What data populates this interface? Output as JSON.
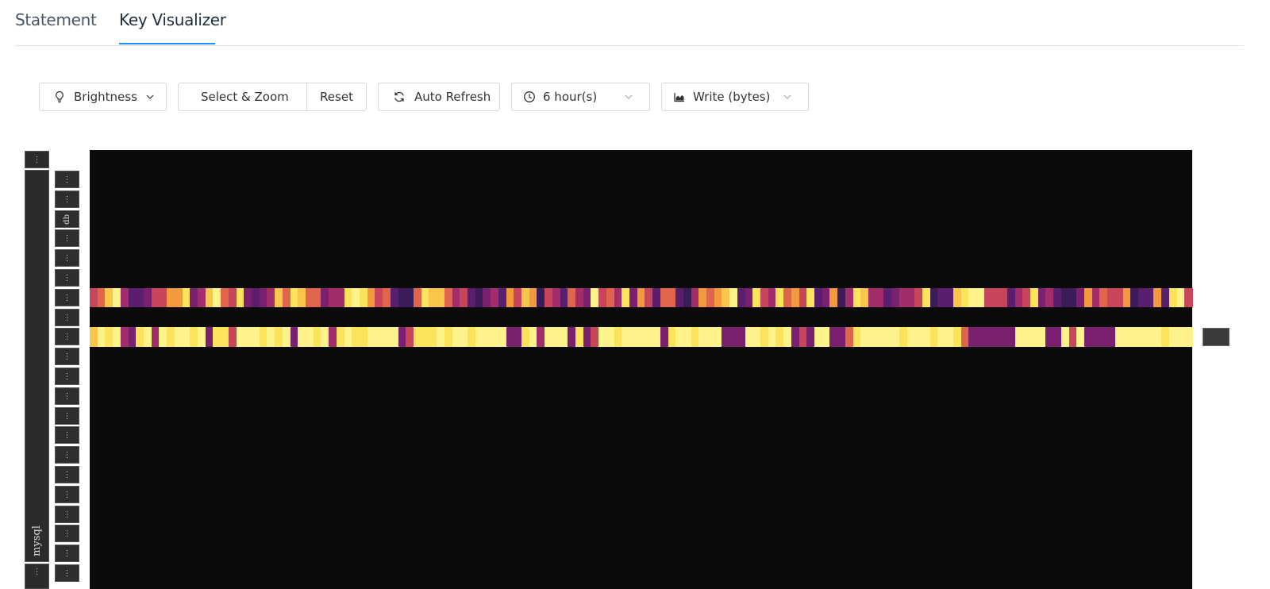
{
  "tabs": [
    {
      "label": "Statement",
      "active": false
    },
    {
      "label": "Key Visualizer",
      "active": true
    }
  ],
  "toolbar": {
    "brightness_label": "Brightness",
    "select_zoom_label": "Select & Zoom",
    "reset_label": "Reset",
    "auto_refresh_label": "Auto Refresh",
    "time_range_value": "6 hour(s)",
    "metric_value": "Write (bytes)"
  },
  "axis": {
    "outer_top_label": "⋮",
    "outer_main_label": "mysql",
    "outer_bottom_label": "⋮",
    "inner_labels": [
      "⋮",
      "⋮",
      "db",
      "⋮",
      "⋮",
      "⋮",
      "⋮",
      "⋮",
      "⋮",
      "⋮",
      "⋮",
      "⋮",
      "⋮",
      "⋮",
      "⋮",
      "⋮",
      "⋮",
      "⋮",
      "⋮",
      "⋮",
      "⋮"
    ]
  },
  "colors": {
    "accent": "#1890ff",
    "heatmap_background": "#0b0b0b",
    "palette": [
      "#3b1c58",
      "#5a1e6e",
      "#7b1f6f",
      "#a32c6a",
      "#c7465c",
      "#e0664b",
      "#f19a3e",
      "#f9c54a",
      "#fce35c",
      "#fdf38a"
    ]
  },
  "heatmap": {
    "rows": [
      {
        "band": "upper",
        "levels": [
          4,
          5,
          7,
          9,
          3,
          1,
          1,
          2,
          4,
          4,
          6,
          6,
          8,
          2,
          3,
          7,
          9,
          5,
          4,
          8,
          2,
          1,
          2,
          3,
          7,
          5,
          8,
          7,
          5,
          5,
          2,
          3,
          3,
          8,
          9,
          8,
          6,
          4,
          5,
          1,
          0,
          0,
          5,
          8,
          7,
          7,
          5,
          3,
          4,
          1,
          0,
          2,
          3,
          1,
          6,
          4,
          7,
          6,
          0,
          4,
          3,
          1,
          5,
          3,
          2,
          9,
          4,
          5,
          3,
          8,
          2,
          6,
          4,
          1,
          5,
          5,
          1,
          0,
          3,
          6,
          5,
          6,
          7,
          9,
          1,
          2,
          8,
          4,
          3,
          8,
          5,
          6,
          4,
          8,
          1,
          2,
          6,
          0,
          3,
          8,
          7,
          3,
          3,
          1,
          2,
          3,
          3,
          4,
          8,
          0,
          1,
          1,
          7,
          8,
          9,
          9,
          4,
          4,
          4,
          1,
          3,
          4,
          8,
          2,
          3,
          1,
          0,
          0,
          2,
          6,
          3,
          5,
          4,
          4,
          6,
          0,
          1,
          1,
          6,
          1,
          8,
          9,
          4
        ]
      },
      {
        "band": "lower",
        "levels": [
          7,
          9,
          8,
          9,
          3,
          2,
          8,
          9,
          3,
          9,
          8,
          9,
          9,
          8,
          9,
          2,
          8,
          8,
          4,
          9,
          9,
          9,
          8,
          9,
          8,
          9,
          2,
          9,
          9,
          8,
          9,
          3,
          8,
          9,
          8,
          8,
          9,
          9,
          9,
          9,
          2,
          4,
          8,
          8,
          8,
          9,
          8,
          9,
          9,
          8,
          9,
          9,
          9,
          9,
          2,
          2,
          8,
          9,
          3,
          9,
          9,
          9,
          2,
          8,
          2,
          4,
          9,
          9,
          8,
          9,
          9,
          9,
          9,
          9,
          2,
          8,
          9,
          9,
          8,
          9,
          9,
          9,
          2,
          2,
          2,
          9,
          9,
          8,
          9,
          8,
          9,
          2,
          4,
          2,
          9,
          9,
          2,
          2,
          5,
          8,
          9,
          9,
          9,
          9,
          9,
          8,
          9,
          9,
          9,
          8,
          9,
          9,
          8,
          5,
          2,
          2,
          2,
          2,
          2,
          2,
          9,
          9,
          9,
          9,
          2,
          2,
          9,
          4,
          9,
          2,
          2,
          2,
          2,
          9,
          9,
          9,
          9,
          9,
          9,
          8,
          9,
          9,
          9
        ]
      }
    ]
  }
}
